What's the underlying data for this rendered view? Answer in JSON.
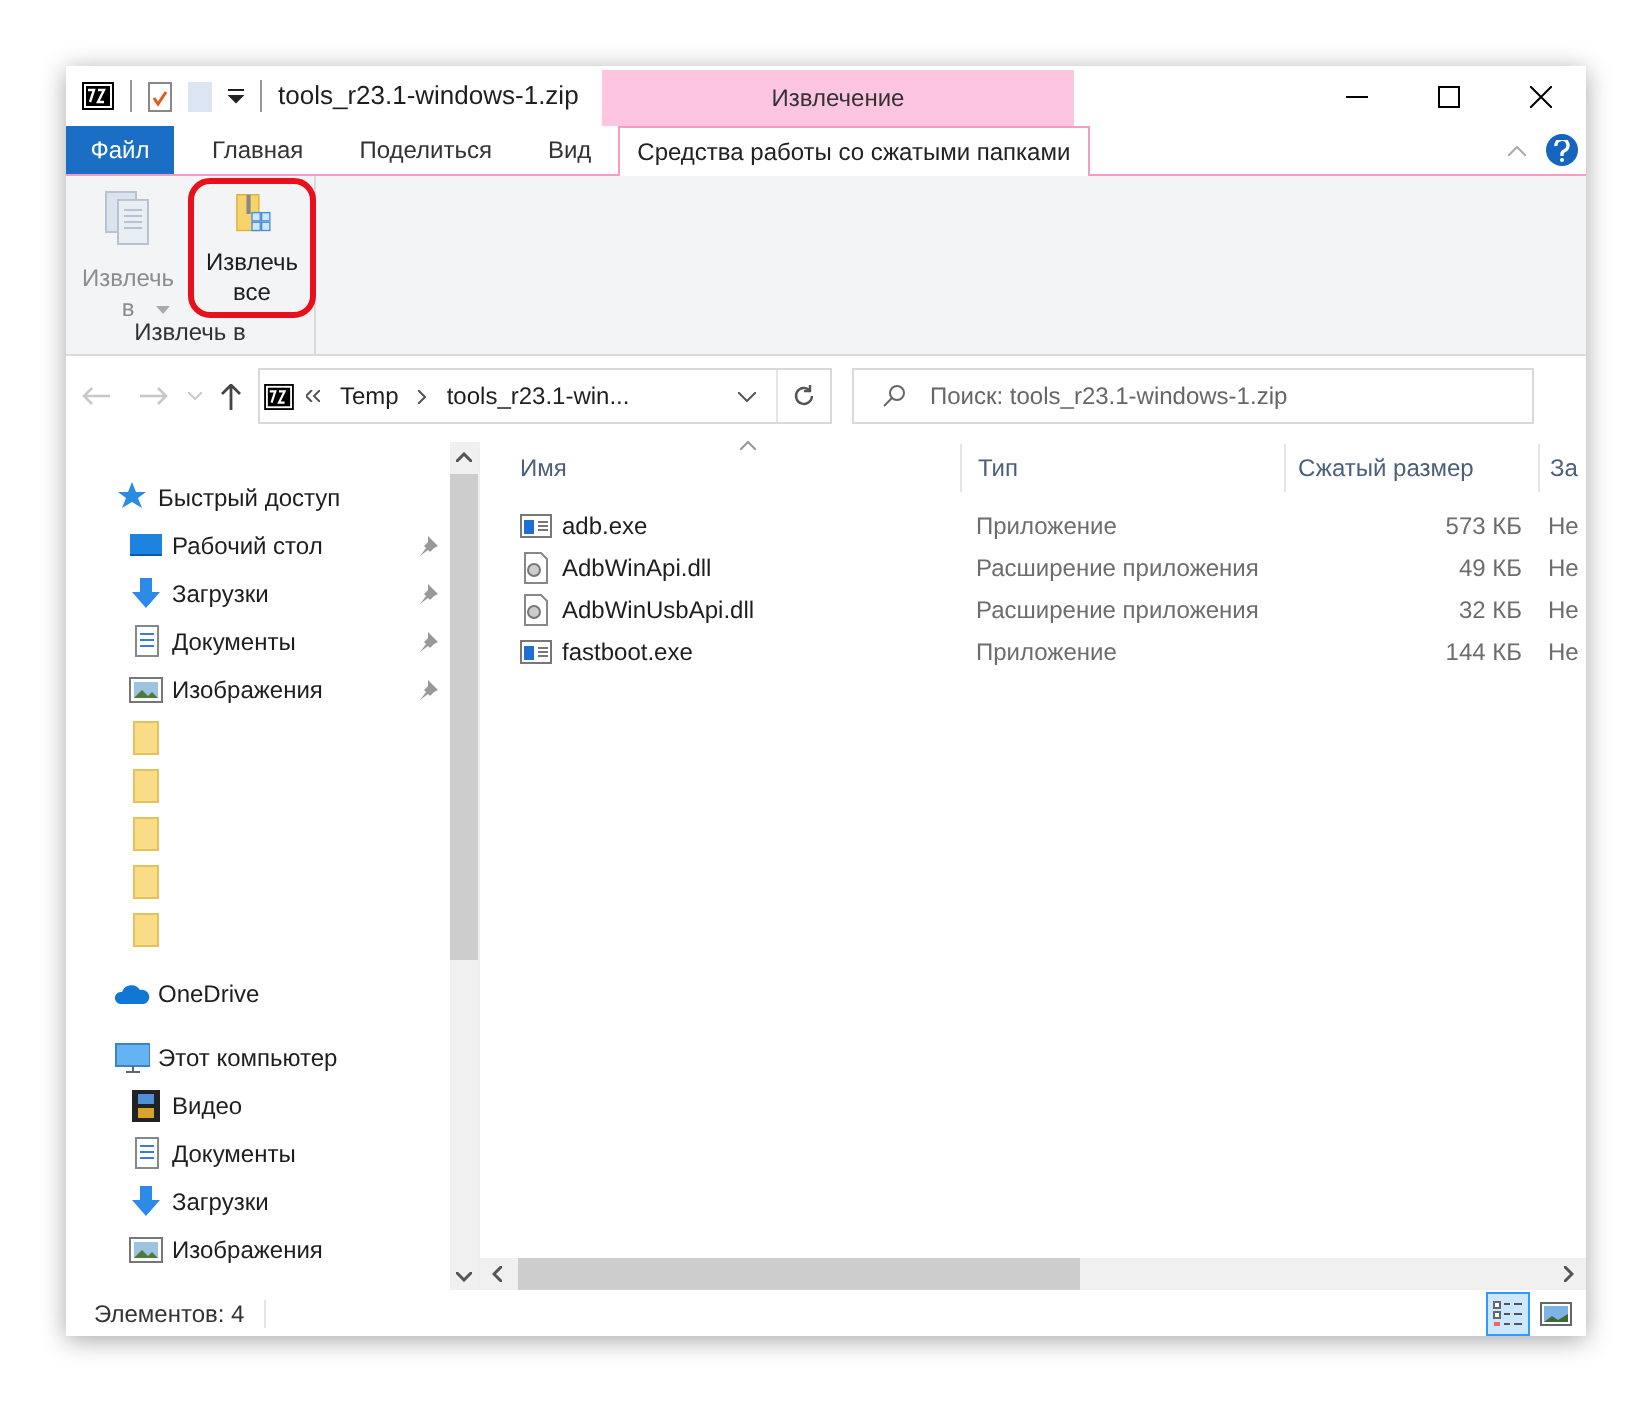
{
  "window": {
    "title": "tools_r23.1-windows-1.zip",
    "context_tab": "Извлечение"
  },
  "ribbon": {
    "tabs": [
      {
        "label": "Файл",
        "kind": "file",
        "selected": false
      },
      {
        "label": "Главная",
        "kind": "tab",
        "selected": false
      },
      {
        "label": "Поделиться",
        "kind": "tab",
        "selected": false
      },
      {
        "label": "Вид",
        "kind": "tab",
        "selected": false
      },
      {
        "label": "Средства работы со сжатыми папками",
        "kind": "context",
        "selected": true
      }
    ],
    "groups": [
      {
        "label": "Извлечь в",
        "buttons": [
          {
            "label": "Извлечь в",
            "kind": "dropdown",
            "disabled": true,
            "highlighted": false
          },
          {
            "label": "Извлечь все",
            "kind": "plain",
            "disabled": false,
            "highlighted": true
          }
        ]
      }
    ]
  },
  "address": {
    "path": [
      "Temp",
      "tools_r23.1-win..."
    ],
    "search_placeholder": "Поиск: tools_r23.1-windows-1.zip"
  },
  "nav": [
    {
      "label": "Быстрый доступ",
      "kind": "star",
      "children": [
        {
          "label": "Рабочий стол",
          "kind": "desktop",
          "pinned": true
        },
        {
          "label": "Загрузки",
          "kind": "download",
          "pinned": true
        },
        {
          "label": "Документы",
          "kind": "doc",
          "pinned": true
        },
        {
          "label": "Изображения",
          "kind": "image",
          "pinned": true
        },
        {
          "kind": "folder",
          "pinned": false
        },
        {
          "kind": "folder",
          "pinned": false
        },
        {
          "kind": "folder",
          "pinned": false
        },
        {
          "kind": "folder",
          "pinned": false
        },
        {
          "kind": "folder",
          "pinned": false
        }
      ]
    },
    {
      "label": "OneDrive",
      "kind": "cloud"
    },
    {
      "label": "Этот компьютер",
      "kind": "pc",
      "children": [
        {
          "label": "Видео",
          "kind": "video",
          "pinned": false
        },
        {
          "label": "Документы",
          "kind": "doc",
          "pinned": false
        },
        {
          "label": "Загрузки",
          "kind": "download",
          "pinned": false
        },
        {
          "label": "Изображения",
          "kind": "image",
          "pinned": false
        }
      ]
    }
  ],
  "table": {
    "columns": [
      "Имя",
      "Тип",
      "Сжатый размер",
      "За"
    ],
    "rows": [
      {
        "kind": "exe",
        "cells": [
          "adb.exe",
          "Приложение",
          "573 КБ",
          "Не"
        ]
      },
      {
        "kind": "dll",
        "cells": [
          "AdbWinApi.dll",
          "Расширение приложения",
          "49 КБ",
          "Не"
        ]
      },
      {
        "kind": "dll",
        "cells": [
          "AdbWinUsbApi.dll",
          "Расширение приложения",
          "32 КБ",
          "Не"
        ]
      },
      {
        "kind": "exe",
        "cells": [
          "fastboot.exe",
          "Приложение",
          "144 КБ",
          "Не"
        ]
      }
    ]
  },
  "status_bar": {
    "text": "Элементов: 4",
    "views": [
      {
        "kind": "details",
        "selected": true
      },
      {
        "kind": "tiles",
        "selected": false
      }
    ]
  }
}
